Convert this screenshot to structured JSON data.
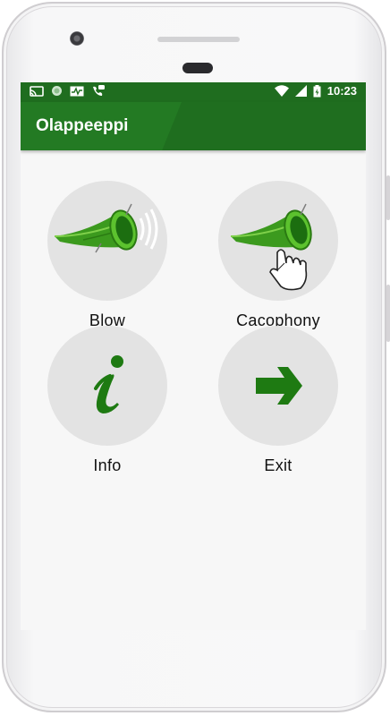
{
  "app": {
    "title": "Olappeeppi"
  },
  "status_bar": {
    "time": "10:23"
  },
  "menu": [
    {
      "label": "Blow",
      "icon": "horn-sound-icon"
    },
    {
      "label": "Cacophony",
      "icon": "horn-hand-icon"
    },
    {
      "label": "Info",
      "icon": "info-icon"
    },
    {
      "label": "Exit",
      "icon": "arrow-right-icon"
    }
  ],
  "colors": {
    "primary": "#237a23",
    "primary_dark": "#1f6d1f",
    "accent_green": "#1e7a12",
    "tile_bg": "#e3e3e3"
  }
}
